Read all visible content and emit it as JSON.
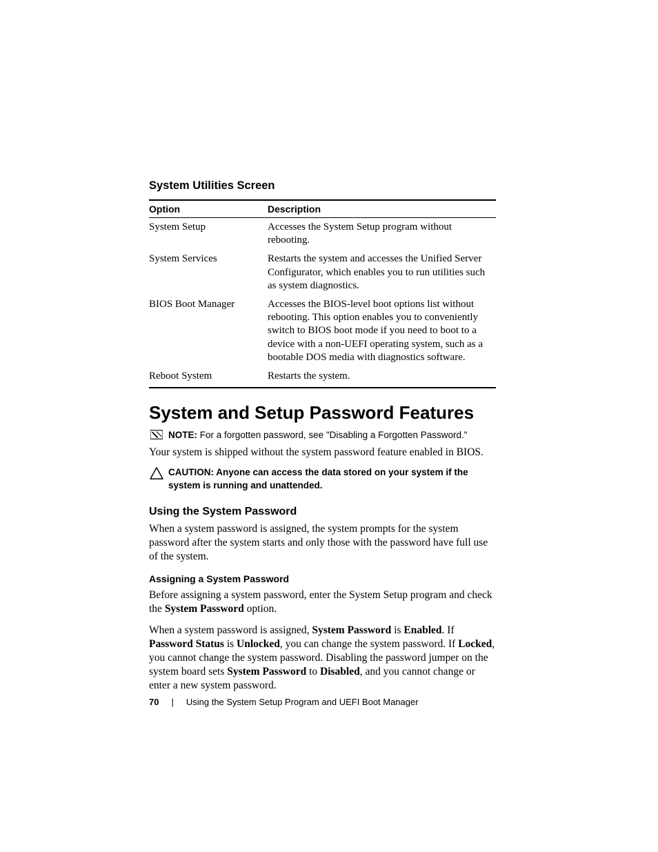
{
  "section_heading": "System Utilities Screen",
  "table": {
    "headers": {
      "option": "Option",
      "description": "Description"
    },
    "rows": [
      {
        "option": "System Setup",
        "description": "Accesses the System Setup program without rebooting."
      },
      {
        "option": "System Services",
        "description": "Restarts the system and accesses the Unified Server Configurator, which enables you to run utilities such as system diagnostics."
      },
      {
        "option": "BIOS Boot Manager",
        "description": "Accesses the BIOS-level boot options list without rebooting. This option enables you to conveniently switch to BIOS boot mode if you need to boot to a device with a non-UEFI operating system, such as a bootable DOS media with diagnostics software."
      },
      {
        "option": "Reboot System",
        "description": "Restarts the system."
      }
    ]
  },
  "h1": "System and Setup Password Features",
  "note": {
    "label": "NOTE:",
    "text": " For a forgotten password, see \"Disabling a Forgotten Password.\""
  },
  "intro_body": "Your system is shipped without the system password feature enabled in BIOS.",
  "caution": {
    "label": "CAUTION:",
    "text": " Anyone can access the data stored on your system if the system is running and unattended."
  },
  "h2a": "Using the System Password",
  "body_a": "When a system password is assigned, the system prompts for the system password after the system starts and only those with the password have full use of the system.",
  "h3a": "Assigning a System Password",
  "body_b": {
    "pre": "Before assigning a system password, enter the System Setup program and check the ",
    "b1": "System Password",
    "post": " option."
  },
  "body_c": {
    "t1": "When a system password is assigned, ",
    "b1": "System Password",
    "t2": " is ",
    "b2": "Enabled",
    "t3": ". If ",
    "b3": "Password Status",
    "t4": " is ",
    "b4": "Unlocked",
    "t5": ", you can change the system password. If ",
    "b5": "Locked",
    "t6": ", you cannot change the system password. Disabling the password jumper on the system board sets ",
    "b6": "System Password",
    "t7": " to ",
    "b7": "Disabled",
    "t8": ", and you cannot change or enter a new system password."
  },
  "footer": {
    "page": "70",
    "separator": "|",
    "title": "Using the System Setup Program and UEFI Boot Manager"
  }
}
